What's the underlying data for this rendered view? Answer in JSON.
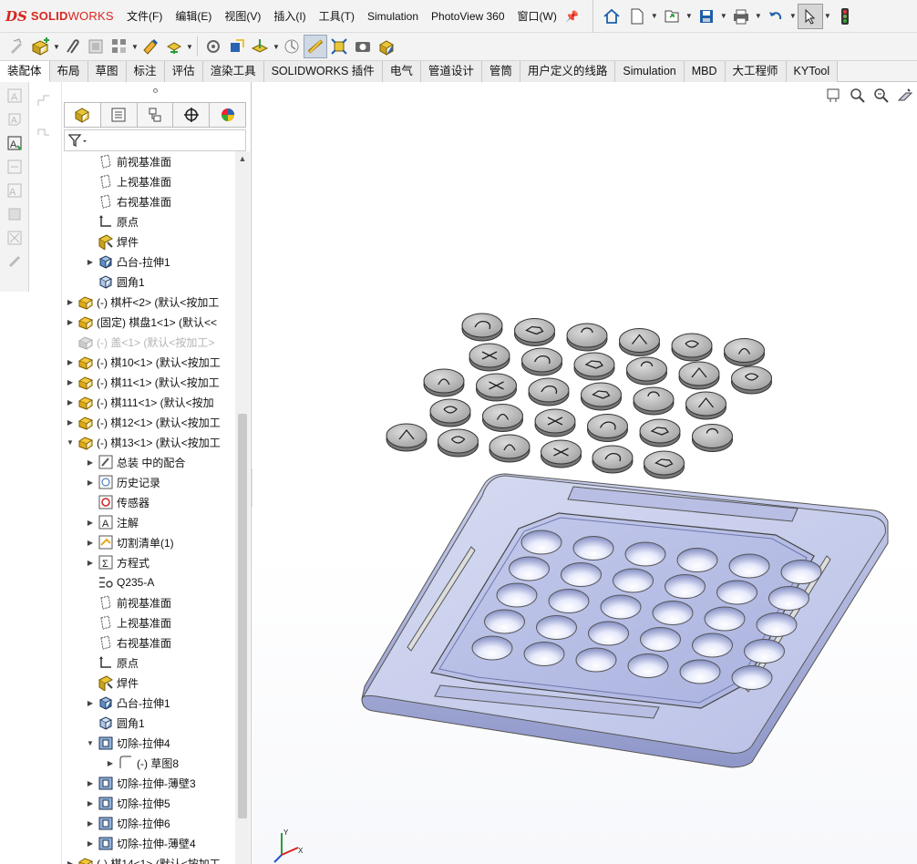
{
  "app": {
    "logo_mark": "DS",
    "brand_bold": "SOLID",
    "brand_light": "WORKS"
  },
  "menu": [
    "文件(F)",
    "编辑(E)",
    "视图(V)",
    "插入(I)",
    "工具(T)",
    "Simulation",
    "PhotoView 360",
    "窗口(W)"
  ],
  "quick_access": {
    "icons": [
      "home-icon",
      "new-document-icon",
      "open-icon",
      "save-icon",
      "print-icon",
      "undo-icon",
      "select-icon",
      "traffic-light-icon"
    ]
  },
  "toolbar": {
    "icons": [
      "edit-component-icon",
      "insert-components-icon",
      "mate-icon",
      "linear-pattern-icon",
      "smart-fasteners-icon",
      "move-component-icon",
      "show-hidden-icon",
      "assembly-features-icon",
      "reference-geometry-icon",
      "new-motion-study-icon",
      "bill-of-materials-icon",
      "exploded-view-icon",
      "instant3d-icon",
      "update-speedpak-icon",
      "snapshot-icon",
      "large-assembly-icon"
    ]
  },
  "command_tabs": [
    "装配体",
    "布局",
    "草图",
    "标注",
    "评估",
    "渲染工具",
    "SOLIDWORKS 插件",
    "电气",
    "管道设计",
    "管筒",
    "用户定义的线路",
    "Simulation",
    "MBD",
    "大工程师",
    "KYTool"
  ],
  "active_tab": "装配体",
  "panel_tabs": [
    "featuremanager-icon",
    "propertymanager-icon",
    "configurationmanager-icon",
    "dimxpert-icon",
    "display-manager-icon"
  ],
  "tree": [
    {
      "label": "前视基准面",
      "icon": "plane-icon",
      "indent": 1,
      "exp": ""
    },
    {
      "label": "上视基准面",
      "icon": "plane-icon",
      "indent": 1,
      "exp": ""
    },
    {
      "label": "右视基准面",
      "icon": "plane-icon",
      "indent": 1,
      "exp": ""
    },
    {
      "label": "原点",
      "icon": "origin-icon",
      "indent": 1,
      "exp": ""
    },
    {
      "label": "焊件",
      "icon": "weldment-icon",
      "indent": 1,
      "exp": ""
    },
    {
      "label": "凸台-拉伸1",
      "icon": "extrude-icon",
      "indent": 1,
      "exp": "▶"
    },
    {
      "label": "圆角1",
      "icon": "fillet-icon",
      "indent": 1,
      "exp": ""
    },
    {
      "label": "(-) 棋杆<2> (默认<按加工",
      "icon": "part-icon",
      "indent": 0,
      "exp": "▶"
    },
    {
      "label": "(固定) 棋盘1<1> (默认<<",
      "icon": "part-icon",
      "indent": 0,
      "exp": "▶"
    },
    {
      "label": "(-) 盖<1> (默认<按加工>",
      "icon": "part-suppressed-icon",
      "indent": 0,
      "exp": "",
      "dim": true
    },
    {
      "label": "(-) 棋10<1> (默认<按加工",
      "icon": "part-icon",
      "indent": 0,
      "exp": "▶"
    },
    {
      "label": "(-) 棋11<1> (默认<按加工",
      "icon": "part-icon",
      "indent": 0,
      "exp": "▶"
    },
    {
      "label": "(-) 棋111<1> (默认<按加",
      "icon": "part-icon",
      "indent": 0,
      "exp": "▶"
    },
    {
      "label": "(-) 棋12<1> (默认<按加工",
      "icon": "part-icon",
      "indent": 0,
      "exp": "▶"
    },
    {
      "label": "(-) 棋13<1> (默认<按加工",
      "icon": "part-icon",
      "indent": 0,
      "exp": "▼"
    },
    {
      "label": "总装 中的配合",
      "icon": "mates-icon",
      "indent": 1,
      "exp": "▶"
    },
    {
      "label": "历史记录",
      "icon": "history-icon",
      "indent": 1,
      "exp": "▶"
    },
    {
      "label": "传感器",
      "icon": "sensor-icon",
      "indent": 1,
      "exp": ""
    },
    {
      "label": "注解",
      "icon": "annotations-icon",
      "indent": 1,
      "exp": "▶"
    },
    {
      "label": "切割清单(1)",
      "icon": "cut-list-icon",
      "indent": 1,
      "exp": "▶"
    },
    {
      "label": "方程式",
      "icon": "equations-icon",
      "indent": 1,
      "exp": "▶"
    },
    {
      "label": "Q235-A",
      "icon": "material-icon",
      "indent": 1,
      "exp": ""
    },
    {
      "label": "前视基准面",
      "icon": "plane-icon",
      "indent": 1,
      "exp": ""
    },
    {
      "label": "上视基准面",
      "icon": "plane-icon",
      "indent": 1,
      "exp": ""
    },
    {
      "label": "右视基准面",
      "icon": "plane-icon",
      "indent": 1,
      "exp": ""
    },
    {
      "label": "原点",
      "icon": "origin-icon",
      "indent": 1,
      "exp": ""
    },
    {
      "label": "焊件",
      "icon": "weldment-icon",
      "indent": 1,
      "exp": ""
    },
    {
      "label": "凸台-拉伸1",
      "icon": "extrude-icon",
      "indent": 1,
      "exp": "▶"
    },
    {
      "label": "圆角1",
      "icon": "fillet-icon",
      "indent": 1,
      "exp": ""
    },
    {
      "label": "切除-拉伸4",
      "icon": "cut-extrude-icon",
      "indent": 1,
      "exp": "▼"
    },
    {
      "label": "(-) 草图8",
      "icon": "sketch-icon",
      "indent": 2,
      "exp": "▶"
    },
    {
      "label": "切除-拉伸-薄壁3",
      "icon": "cut-extrude-icon",
      "indent": 1,
      "exp": "▶"
    },
    {
      "label": "切除-拉伸5",
      "icon": "cut-extrude-icon",
      "indent": 1,
      "exp": "▶"
    },
    {
      "label": "切除-拉伸6",
      "icon": "cut-extrude-icon",
      "indent": 1,
      "exp": "▶"
    },
    {
      "label": "切除-拉伸-薄壁4",
      "icon": "cut-extrude-icon",
      "indent": 1,
      "exp": "▶"
    },
    {
      "label": "(-) 棋14<1> (默认<按加工",
      "icon": "part-icon",
      "indent": 0,
      "exp": "▶"
    }
  ],
  "viewport_tools": [
    "zoom-to-fit-icon",
    "zoom-to-area-icon",
    "previous-view-icon",
    "section-view-icon"
  ],
  "model": {
    "pieces_rows": [
      6,
      6,
      6,
      6,
      6
    ],
    "board_holes_rows": 6,
    "board_holes_cols": 5
  }
}
